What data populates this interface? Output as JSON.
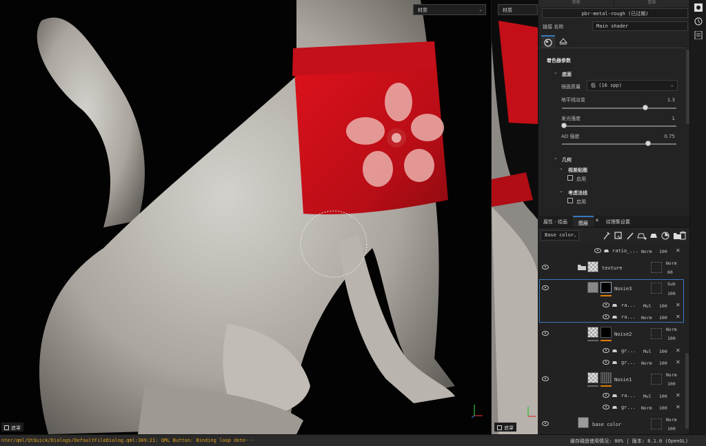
{
  "viewport_main": {
    "dropdown_label": "材质",
    "mask_label": "遮罩"
  },
  "viewport_split": {
    "dropdown_label": "材质",
    "mask_label": "遮罩"
  },
  "properties": {
    "top_tabs": [
      "图像",
      "重载"
    ],
    "shader_name_field": "pbr-metal-rough (已过期)",
    "link_name_label": "链接 名称",
    "link_name_value": "Main shader",
    "section_title": "着色器参数",
    "groups": {
      "base": {
        "title": "底面",
        "quality_label": "镜面质量",
        "quality_value": "低 (16 spp)",
        "horizon_label": "地平线淡变",
        "horizon_value": "1.3",
        "horizon_fraction": 0.73,
        "emissive_label": "发光强度",
        "emissive_value": "1",
        "emissive_fraction": 0.02,
        "ao_label": "AO 强度",
        "ao_value": "0.75",
        "ao_fraction": 0.75
      },
      "geometry": {
        "title": "几何",
        "parallax_title": "视差贴图",
        "parallax_enable": "启用",
        "normals_title": "考虑法线",
        "normals_enable": "启用"
      }
    }
  },
  "layer_tabs": {
    "tab1": "属性 - 绘画",
    "tab2": "图层",
    "tab3": "纹理集设置"
  },
  "layer_toolbar": {
    "channel_select": "Base color"
  },
  "layers": [
    {
      "name": "ratio_...",
      "blend": "Norm",
      "opacity": "100",
      "type": "sub"
    },
    {
      "name": "texture",
      "blend": "Norm",
      "opacity": "60",
      "type": "folder"
    },
    {
      "name": "Nosie3",
      "blend": "Sub",
      "opacity": "100",
      "type": "fill-dark"
    },
    {
      "name": "ra...",
      "blend": "Mul",
      "opacity": "100",
      "type": "sub"
    },
    {
      "name": "ra...",
      "blend": "Norm",
      "opacity": "100",
      "type": "sub"
    },
    {
      "name": "Noise2",
      "blend": "Norm",
      "opacity": "100",
      "type": "fill-dark"
    },
    {
      "name": "gr...",
      "blend": "Mul",
      "opacity": "100",
      "type": "sub"
    },
    {
      "name": "gr...",
      "blend": "Norm",
      "opacity": "100",
      "type": "sub"
    },
    {
      "name": "Nosie1",
      "blend": "Norm",
      "opacity": "100",
      "type": "fill-noise"
    },
    {
      "name": "ra...",
      "blend": "Mul",
      "opacity": "100",
      "type": "sub"
    },
    {
      "name": "gr...",
      "blend": "Norm",
      "opacity": "100",
      "type": "sub"
    },
    {
      "name": "base color",
      "blend": "Norm",
      "opacity": "100",
      "type": "fill-grey"
    }
  ],
  "status": {
    "message": "nter/qml/QtQuick/Dialogs/DefaultFileDialog.qml:309:21: QML Button: Binding loop dete···",
    "cache": "缓存磁盘使用情况:  80% | 版本: 8.1.0 (OpenGL)"
  },
  "colors": {
    "accent_blue": "#3a78c0",
    "status_orange": "#e0a020",
    "layer_marker": "#e07b00",
    "cloth_red": "#d0101a"
  }
}
